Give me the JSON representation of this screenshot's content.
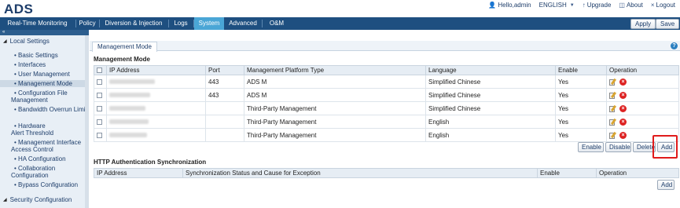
{
  "app": {
    "logo": "ADS"
  },
  "user_links": {
    "hello": "Hello,admin",
    "language": "ENGLISH",
    "upgrade": "Upgrade",
    "about": "About",
    "logout": "Logout"
  },
  "nav": {
    "tabs": [
      "Real-Time Monitoring",
      "Policy",
      "Diversion & Injection",
      "Logs",
      "System",
      "Advanced",
      "O&M"
    ],
    "active": "System",
    "apply": "Apply",
    "save": "Save"
  },
  "sidebar": {
    "collapse": "«",
    "sections": [
      {
        "label": "Local Settings"
      },
      {
        "label": "Security Configuration"
      }
    ],
    "items": [
      {
        "label": "Basic Settings"
      },
      {
        "label": "Interfaces"
      },
      {
        "label": "User Management"
      },
      {
        "label": "Management Mode"
      },
      {
        "label": "Configuration File Management"
      },
      {
        "label": "Bandwidth Overrun Limit"
      },
      {
        "label": "Hardware Alert Threshold"
      },
      {
        "label": "Management Interface Access Control"
      },
      {
        "label": "HA Configuration"
      },
      {
        "label": "Collaboration Configuration"
      },
      {
        "label": "Bypass Configuration"
      }
    ]
  },
  "content": {
    "tab": "Management Mode",
    "help": "?",
    "section1_title": "Management Mode",
    "mgmt_columns": [
      "IP Address",
      "Port",
      "Management Platform Type",
      "Language",
      "Enable",
      "Operation"
    ],
    "mgmt_rows": [
      {
        "port": "443",
        "type": "ADS M",
        "language": "Simplified Chinese",
        "enable": "Yes"
      },
      {
        "port": "443",
        "type": "ADS M",
        "language": "Simplified Chinese",
        "enable": "Yes"
      },
      {
        "port": "",
        "type": "Third-Party Management",
        "language": "Simplified Chinese",
        "enable": "Yes"
      },
      {
        "port": "",
        "type": "Third-Party Management",
        "language": "English",
        "enable": "Yes"
      },
      {
        "port": "",
        "type": "Third-Party Management",
        "language": "English",
        "enable": "Yes"
      }
    ],
    "buttons": {
      "enable": "Enable",
      "disable": "Disable",
      "delete": "Delete",
      "add": "Add"
    },
    "section2_title": "HTTP Authentication Synchronization",
    "http_columns": [
      "IP Address",
      "Synchronization Status and Cause for Exception",
      "Enable",
      "Operation"
    ],
    "http_add": "Add"
  },
  "colors": {
    "nav_bg": "#1e4f80",
    "nav_active": "#4aa6d6",
    "highlight": "#e01b1b"
  }
}
